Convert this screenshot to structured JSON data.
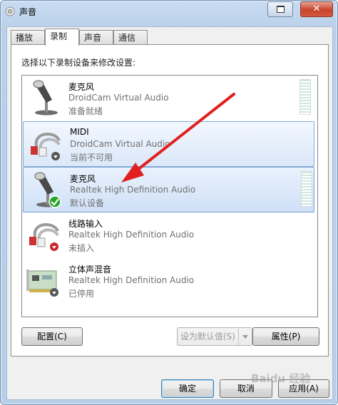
{
  "window": {
    "title": "声音"
  },
  "tabs": [
    {
      "label": "播放"
    },
    {
      "label": "录制"
    },
    {
      "label": "声音"
    },
    {
      "label": "通信"
    }
  ],
  "instruction": "选择以下录制设备来修改设置:",
  "devices": [
    {
      "name": "麦克风",
      "driver": "DroidCam Virtual Audio",
      "status": "准备就绪",
      "icon": "microphone-icon"
    },
    {
      "name": "MIDI",
      "driver": "DroidCam Virtual Audio",
      "status": "当前不可用",
      "icon": "line-in-cable-icon"
    },
    {
      "name": "麦克风",
      "driver": "Realtek High Definition Audio",
      "status": "默认设备",
      "icon": "microphone-icon"
    },
    {
      "name": "线路输入",
      "driver": "Realtek High Definition Audio",
      "status": "未插入",
      "icon": "line-in-cable-icon"
    },
    {
      "name": "立体声混音",
      "driver": "Realtek High Definition Audio",
      "status": "已停用",
      "icon": "sound-card-icon"
    }
  ],
  "buttons": {
    "configure": "配置(C)",
    "set_default": "设为默认值(S)",
    "properties": "属性(P)",
    "ok": "确定",
    "cancel": "取消",
    "apply": "应用(A)"
  },
  "watermark": "Baidu 经验",
  "colors": {
    "annotation_arrow": "#e02020",
    "default_check": "#2aa52a"
  }
}
